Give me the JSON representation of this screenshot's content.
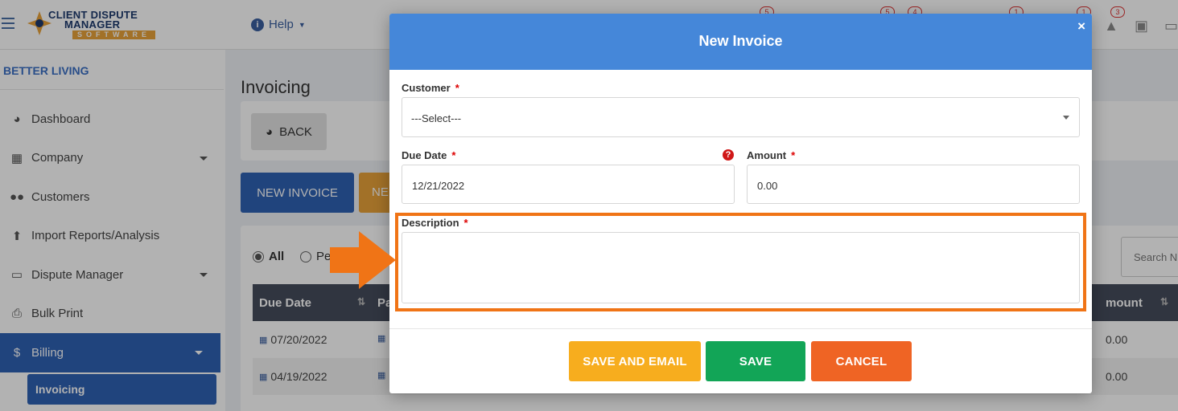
{
  "app": {
    "logo_line1": "CLIENT DISPUTE",
    "logo_line2": "MANAGER",
    "logo_line3": "SOFTWARE",
    "help_label": "Help",
    "badges": [
      "5",
      "5",
      "4",
      "1",
      "1",
      "3"
    ],
    "icons": [
      "hamburger-icon",
      "help-icon",
      "alert-icon",
      "briefcase-icon",
      "card-icon"
    ]
  },
  "sidebar": {
    "org_name": "BETTER LIVING",
    "items": [
      {
        "label": "Dashboard",
        "icon": "pie-chart-icon"
      },
      {
        "label": "Company",
        "icon": "building-icon"
      },
      {
        "label": "Customers",
        "icon": "users-icon"
      },
      {
        "label": "Import Reports/Analysis",
        "icon": "file-upload-icon"
      },
      {
        "label": "Dispute Manager",
        "icon": "laptop-icon"
      },
      {
        "label": "Bulk Print",
        "icon": "print-icon"
      },
      {
        "label": "Billing",
        "icon": "invoice-icon"
      }
    ],
    "sub_active": "Invoicing"
  },
  "main": {
    "title": "Invoicing",
    "back_label": "BACK",
    "new_invoice_label": "NEW INVOICE",
    "second_button_label": "NE",
    "filters": [
      "All",
      "Pe"
    ],
    "search_placeholder": "Search N",
    "table": {
      "headers": [
        "Due Date",
        "Pa",
        "mount"
      ],
      "rows": [
        {
          "due_date": "07/20/2022",
          "amount": "0.00"
        },
        {
          "due_date": "04/19/2022",
          "amount": "0.00"
        }
      ]
    }
  },
  "modal": {
    "title": "New Invoice",
    "close_label": "×",
    "customer": {
      "label": "Customer",
      "required": "*",
      "value": "---Select---"
    },
    "due_date": {
      "label": "Due Date",
      "required": "*",
      "value": "12/21/2022"
    },
    "amount": {
      "label": "Amount",
      "required": "*",
      "value": "0.00"
    },
    "description": {
      "label": "Description",
      "required": "*",
      "value": ""
    },
    "buttons": {
      "save_email": "SAVE AND EMAIL",
      "save": "SAVE",
      "cancel": "CANCEL"
    },
    "colors": {
      "header": "#4587d9",
      "save_email": "#f7ad1e",
      "save": "#12a557",
      "cancel": "#ef6424",
      "highlight": "#f07416"
    }
  }
}
